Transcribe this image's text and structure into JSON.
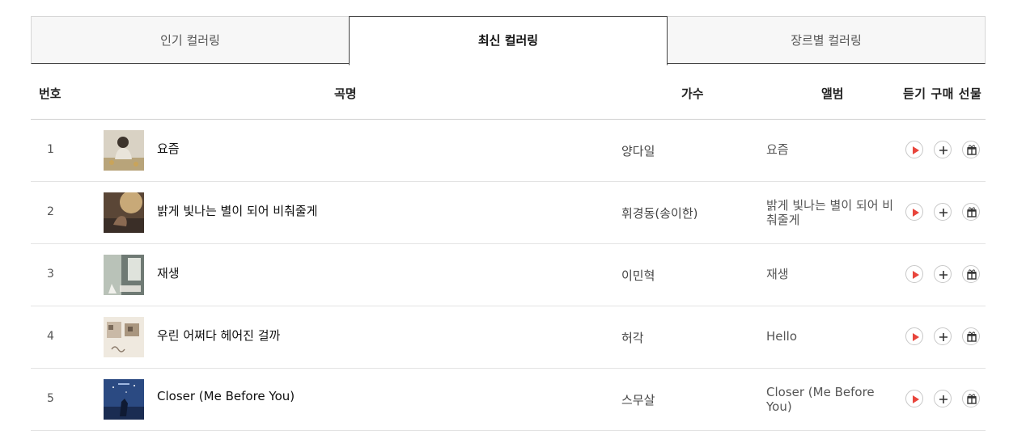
{
  "tabs": [
    {
      "label": "인기 컬러링",
      "active": false
    },
    {
      "label": "최신 컬러링",
      "active": true
    },
    {
      "label": "장르별 컬러링",
      "active": false
    }
  ],
  "columns": {
    "no": "번호",
    "title": "곡명",
    "artist": "가수",
    "album": "앨범",
    "actions": "듣기 구매 선물"
  },
  "rows": [
    {
      "no": "1",
      "title": "요즘",
      "artist": "양다일",
      "album": "요즘",
      "thumb_icon": "album-cover-person-sitting"
    },
    {
      "no": "2",
      "title": "밝게 빛나는 별이 되어 비춰줄게",
      "artist": "휘경동(송이한)",
      "album": "밝게 빛나는 별이 되어 비춰줄게",
      "thumb_icon": "album-cover-warm-light"
    },
    {
      "no": "3",
      "title": "재생",
      "artist": "이민혁",
      "album": "재생",
      "thumb_icon": "album-cover-play"
    },
    {
      "no": "4",
      "title": "우린 어쩌다 헤어진 걸까",
      "artist": "허각",
      "album": "Hello",
      "thumb_icon": "album-cover-hello"
    },
    {
      "no": "5",
      "title": "Closer (Me Before You)",
      "artist": "스무살",
      "album": "Closer (Me Before You)",
      "thumb_icon": "album-cover-night-blue"
    }
  ],
  "icons": {
    "play": "play-icon",
    "add": "plus-icon",
    "gift": "gift-icon"
  },
  "colors": {
    "play_accent": "#e8453c"
  }
}
